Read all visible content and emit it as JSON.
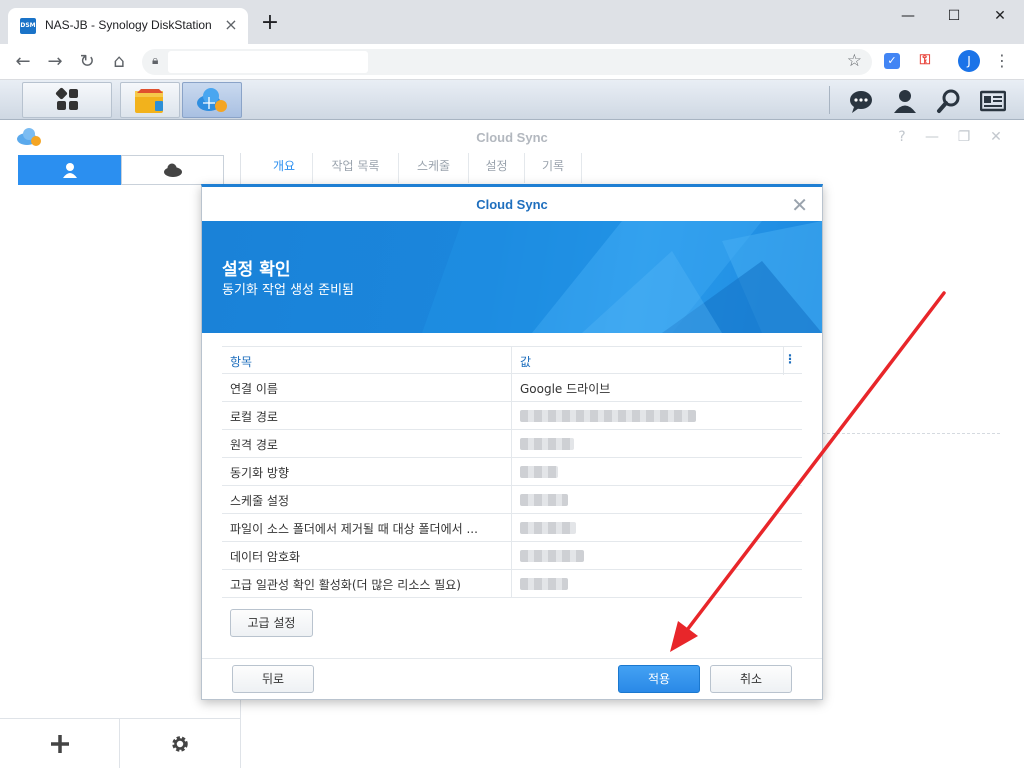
{
  "browser": {
    "tab_title": "NAS-JB - Synology DiskStation",
    "favicon_text": "DSM",
    "avatar_letter": "J",
    "icons": [
      "close-icon",
      "new-tab-icon",
      "back-icon",
      "forward-icon",
      "reload-icon",
      "home-icon",
      "lock-icon",
      "star-icon",
      "menu-icon"
    ]
  },
  "dsm": {
    "taskbar_icons": [
      "main-menu-icon",
      "package-center-icon",
      "cloud-sync-icon",
      "notification-icon",
      "user-icon",
      "search-icon",
      "widgets-icon"
    ]
  },
  "app": {
    "title": "Cloud Sync",
    "tabs": [
      "개요",
      "작업 목록",
      "스케줄",
      "설정",
      "기록"
    ],
    "active_tab": "개요"
  },
  "dialog": {
    "title": "Cloud Sync",
    "banner_title": "설정 확인",
    "banner_subtitle": "동기화 작업 생성 준비됨",
    "table": {
      "headers": {
        "key": "항목",
        "value": "값"
      },
      "rows": [
        {
          "key": "연결 이름",
          "value": "Google 드라이브"
        },
        {
          "key": "로컬 경로",
          "value": ""
        },
        {
          "key": "원격 경로",
          "value": ""
        },
        {
          "key": "동기화 방향",
          "value": ""
        },
        {
          "key": "스케줄 설정",
          "value": ""
        },
        {
          "key": "파일이 소스 폴더에서 제거될 때 대상 폴더에서 ...",
          "value": ""
        },
        {
          "key": "데이터 암호화",
          "value": ""
        },
        {
          "key": "고급 일관성 확인 활성화(더 많은 리소스 필요)",
          "value": ""
        }
      ]
    },
    "advanced_button": "고급 설정",
    "back_button": "뒤로",
    "apply_button": "적용",
    "cancel_button": "취소"
  },
  "colors": {
    "accent": "#2b8ff0",
    "banner": "#1a82d8",
    "arrow": "#e8262a"
  }
}
